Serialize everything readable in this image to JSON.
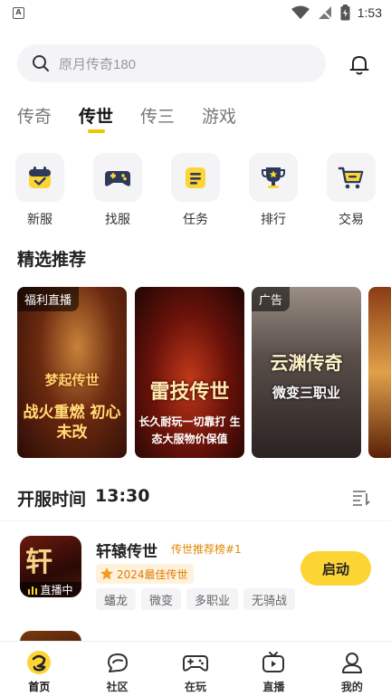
{
  "status_bar": {
    "time": "1:53",
    "left_badge": "A"
  },
  "search": {
    "placeholder": "原月传奇180"
  },
  "tabs": [
    {
      "label": "传奇",
      "active": false
    },
    {
      "label": "传世",
      "active": true
    },
    {
      "label": "传三",
      "active": false
    },
    {
      "label": "游戏",
      "active": false
    }
  ],
  "entries": [
    {
      "label": "新服",
      "icon": "calendar-check-icon"
    },
    {
      "label": "找服",
      "icon": "gamepad-icon"
    },
    {
      "label": "任务",
      "icon": "task-list-icon"
    },
    {
      "label": "排行",
      "icon": "trophy-icon"
    },
    {
      "label": "交易",
      "icon": "cart-icon"
    }
  ],
  "featured": {
    "title": "精选推荐",
    "banners": [
      {
        "tag": "福利直播",
        "title": "梦起传世",
        "subtitle": "战火重燃 初心未改"
      },
      {
        "tag": "",
        "title": "雷技传世",
        "subtitle": "长久耐玩一切靠打 生态大服物价保值"
      },
      {
        "tag": "广告",
        "title": "云渊传奇",
        "subtitle": "微变三职业"
      }
    ]
  },
  "open_server": {
    "label": "开服时间",
    "time": "13:30"
  },
  "games": [
    {
      "name": "轩辕传世",
      "rank": "传世推荐榜#1",
      "award": "2024最佳传世",
      "tags": [
        "蟠龙",
        "微变",
        "多职业",
        "无骑战"
      ],
      "live_label": "直播中",
      "action": "启动"
    }
  ],
  "bottom_nav": [
    {
      "label": "首页",
      "icon": "home-icon",
      "active": true
    },
    {
      "label": "社区",
      "icon": "community-icon",
      "active": false
    },
    {
      "label": "在玩",
      "icon": "controller-icon",
      "active": false
    },
    {
      "label": "直播",
      "icon": "tv-icon",
      "active": false
    },
    {
      "label": "我的",
      "icon": "profile-icon",
      "active": false
    }
  ],
  "colors": {
    "accent": "#fcd535",
    "tab_underline": "#f2c500",
    "award_text": "#e07a00"
  }
}
